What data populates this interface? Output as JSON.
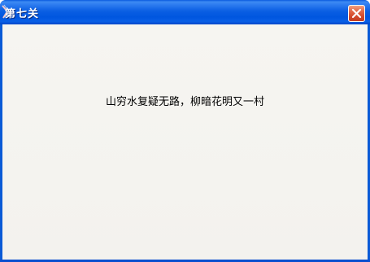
{
  "window": {
    "title": "第七关",
    "message": "山穷水复疑无路，柳暗花明又一村"
  },
  "icons": {
    "app": "app-icon",
    "close": "close-icon"
  },
  "colors": {
    "titlebar": "#0a5ad6",
    "client": "#f4f3ef",
    "close_button": "#d9532f"
  }
}
